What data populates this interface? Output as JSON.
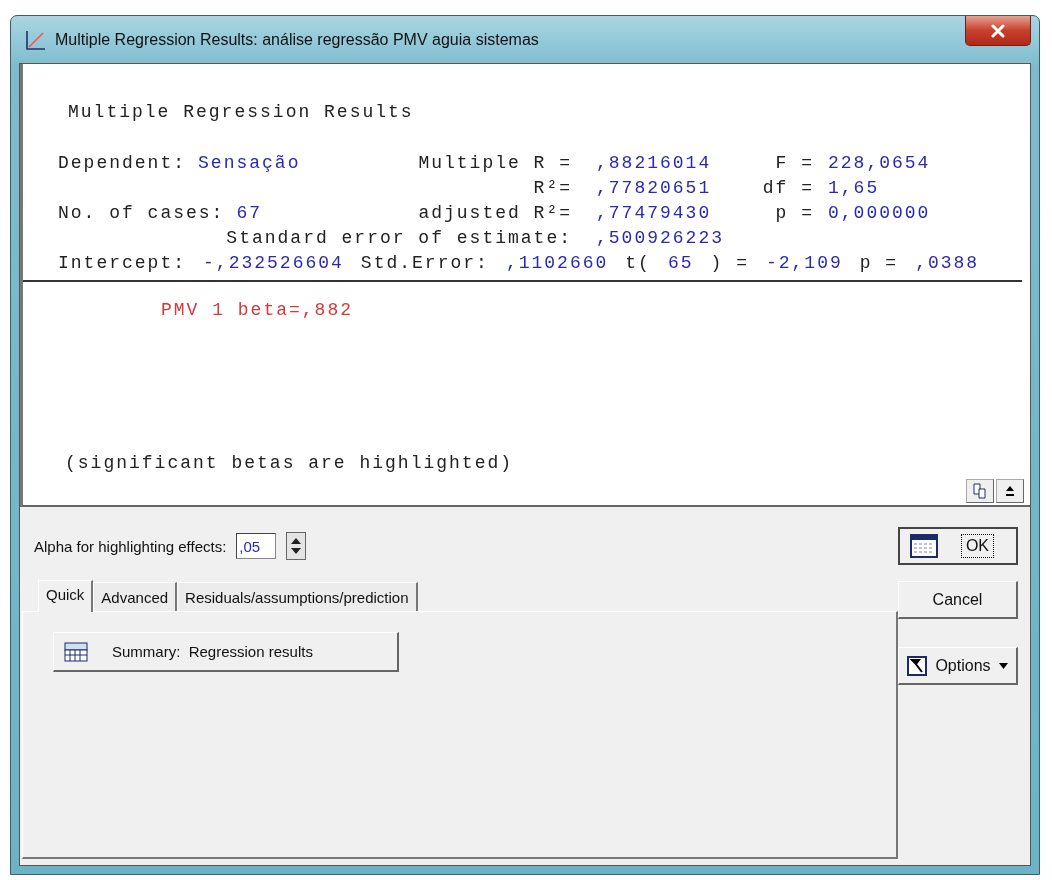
{
  "window": {
    "title": "Multiple Regression Results: análise regressão PMV aguia sistemas"
  },
  "results": {
    "heading": "Multiple Regression Results",
    "stat_rows": [
      {
        "left": {
          "label": "Dependent:",
          "value": "Sensação"
        },
        "middle": {
          "label": "Multiple R =",
          "value": ",88216014"
        },
        "right": {
          "label": "F =",
          "value": "228,0654"
        }
      },
      {
        "middle": {
          "label": "R²=",
          "value": ",77820651"
        },
        "right": {
          "label": "df =",
          "value": "1,65"
        }
      },
      {
        "left": {
          "label": "No. of cases:",
          "value": "67"
        },
        "middle": {
          "label": "adjusted R²=",
          "value": ",77479430"
        },
        "right": {
          "label": "p =",
          "value": "0,000000"
        }
      }
    ],
    "standard_error": {
      "label": "Standard error of estimate:",
      "value": ",500926223"
    },
    "intercept_line": [
      {
        "text": "Intercept:",
        "kind": "label"
      },
      {
        "text": "-,232526604",
        "kind": "value"
      },
      {
        "text": "Std.Error:",
        "kind": "label"
      },
      {
        "text": ",1102660",
        "kind": "value"
      },
      {
        "text": "t(",
        "kind": "label"
      },
      {
        "text": "65",
        "kind": "value"
      },
      {
        "text": ") =",
        "kind": "label"
      },
      {
        "text": "-2,109",
        "kind": "value"
      },
      {
        "text": "p =",
        "kind": "label"
      },
      {
        "text": ",0388",
        "kind": "value"
      }
    ],
    "betas": [
      {
        "text": "PMV 1 beta=,882",
        "highlighted": true
      }
    ],
    "footnote": "(significant betas are highlighted)"
  },
  "alpha": {
    "label": "Alpha for highlighting effects:",
    "value": ",05"
  },
  "tabs": [
    {
      "label": "Quick",
      "selected": true
    },
    {
      "label": "Advanced",
      "selected": false
    },
    {
      "label": "Residuals/assumptions/prediction",
      "selected": false
    }
  ],
  "tab_buttons": [
    {
      "label": "Summary:  Regression results"
    }
  ],
  "side_buttons": [
    {
      "label": "OK",
      "kind": "ok",
      "focused": true
    },
    {
      "label": "Cancel",
      "kind": "plain",
      "focused": false
    },
    {
      "label": "Options",
      "kind": "menu",
      "focused": false
    }
  ]
}
